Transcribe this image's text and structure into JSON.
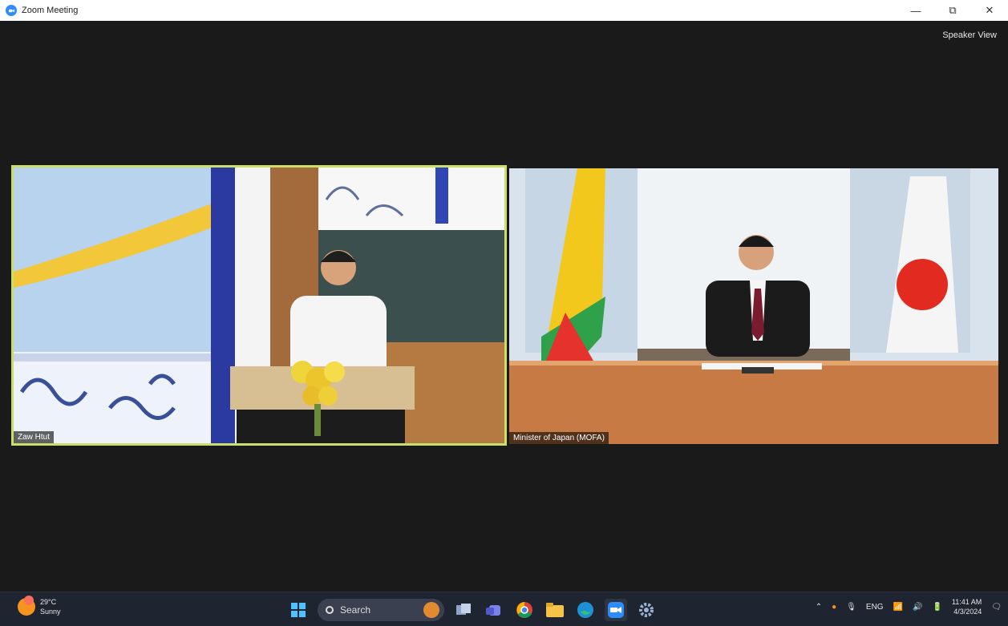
{
  "window": {
    "title": "Zoom Meeting",
    "minimize": "—",
    "restore": "⧉",
    "close": "✕"
  },
  "meeting": {
    "view_button": "Speaker View",
    "participants": [
      {
        "name": "Zaw Htut",
        "active_speaker": true
      },
      {
        "name": "Minister of Japan (MOFA)",
        "active_speaker": false
      }
    ]
  },
  "taskbar": {
    "weather": {
      "temp": "29°C",
      "condition": "Sunny"
    },
    "search_placeholder": "Search",
    "apps": [
      "start-icon",
      "search",
      "task-view-icon",
      "teams-icon",
      "chrome-icon",
      "file-explorer-icon",
      "edge-icon",
      "zoom-icon",
      "settings-icon"
    ],
    "tray": {
      "language": "ENG",
      "time": "11:41 AM",
      "date": "4/3/2024"
    }
  },
  "colors": {
    "active_speaker_border": "#c8e06a",
    "taskbar_bg": "#1f2530",
    "stage_bg": "#1a1a1a"
  }
}
